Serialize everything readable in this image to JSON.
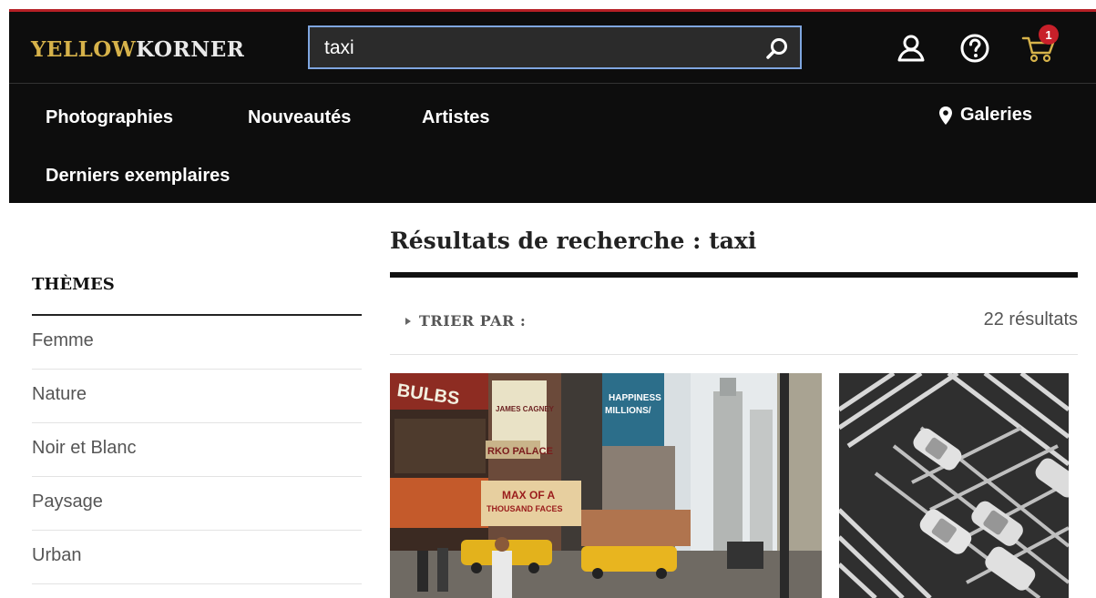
{
  "header": {
    "logo_part1": "YELLOW",
    "logo_part2": "KORNER",
    "search": {
      "value": "taxi"
    },
    "cart_count": "1"
  },
  "nav": {
    "items": [
      "Photographies",
      "Nouveautés",
      "Artistes",
      "Derniers exemplaires"
    ],
    "galeries": "Galeries"
  },
  "results": {
    "title": "Résultats de recherche : taxi",
    "sort_label": "TRIER PAR :",
    "count": "22 résultats",
    "items": [
      {
        "signs": [
          "BULBS",
          "HAPPINESS",
          "MILLIONS/",
          "JAMES CAGNEY",
          "RKO PALACE",
          "MAX OF A",
          "THOUSAND FACES"
        ]
      },
      {
        "signs": []
      }
    ]
  },
  "sidebar": {
    "title": "THÈMES",
    "themes": [
      "Femme",
      "Nature",
      "Noir et Blanc",
      "Paysage",
      "Urban"
    ]
  },
  "colors": {
    "brand_yellow": "#d6b24a",
    "header_bg": "#0d0d0d",
    "accent_red": "#b52025",
    "search_border": "#7fa6e0",
    "badge_red": "#c8202a"
  },
  "icons": [
    "search-icon",
    "account-icon",
    "help-icon",
    "cart-icon",
    "map-pin-icon",
    "caret-right-icon"
  ]
}
